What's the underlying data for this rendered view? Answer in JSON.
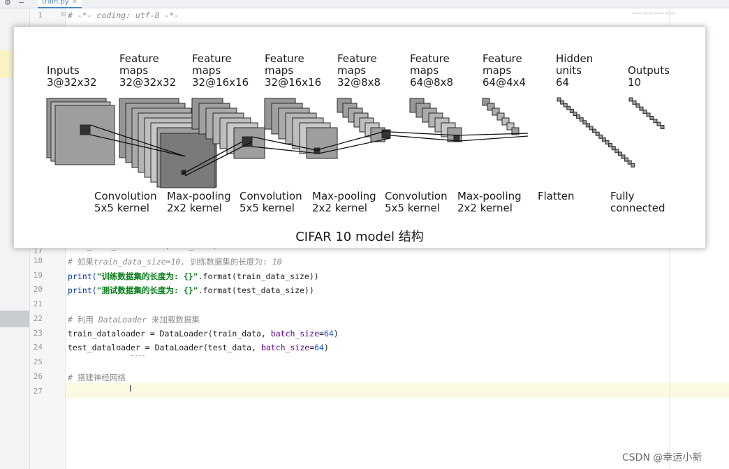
{
  "tabs": [
    {
      "label": "train.py"
    }
  ],
  "code_lines": [
    {
      "n": "1",
      "text": "# -*- coding: utf-8 -*-"
    },
    {
      "n": "17",
      "text": "test_data_size = len(test_data)"
    },
    {
      "n": "18",
      "text": "# 如果train_data_size=10, 训练数据集的长度为: 10"
    },
    {
      "n": "19",
      "text": "print(\"训练数据集的长度为: {}\".format(train_data_size))"
    },
    {
      "n": "20",
      "text": "print(\"测试数据集的长度为: {}\".format(test_data_size))"
    },
    {
      "n": "21",
      "text": ""
    },
    {
      "n": "22",
      "text": "# 利用 DataLoader 来加载数据集"
    },
    {
      "n": "23",
      "text": "train_dataloader = DataLoader(train_data, batch_size=64)"
    },
    {
      "n": "24",
      "text": "test_dataloader = DataLoader(test_data, batch_size=64)"
    },
    {
      "n": "25",
      "text": ""
    },
    {
      "n": "26",
      "text": "# 搭建神经网络"
    },
    {
      "n": "27",
      "text": ""
    }
  ],
  "code_parts": {
    "l18_a": "# 如果",
    "l18_b": "train_data_size=10,",
    "l18_c": " 训练数据集的长度为: ",
    "l18_d": "10",
    "l19_a": "print(",
    "l19_b": "\"训练数据集的长度为: {}\"",
    "l19_c": ".format(train_data_size))",
    "l20_a": "print(",
    "l20_b": "\"测试数据集的长度为: {}\"",
    "l20_c": ".format(test_data_size))",
    "l22_a": "# 利用 ",
    "l22_b": "DataLoader",
    "l22_c": " 来加载数据集",
    "l23_a": "train_dataloader = DataLoader(train_data, ",
    "l23_b": "batch_size",
    "l23_c": "=",
    "l23_d": "64",
    "l23_e": ")",
    "l24_a": "test_dataloader = DataLoader(test_data, ",
    "l24_b": "batch_size",
    "l24_c": "=",
    "l24_d": "64",
    "l24_e": ")",
    "l26": "# 搭建神经网络"
  },
  "figure": {
    "headers": [
      {
        "label": "Inputs\n3@32x32"
      },
      {
        "label": "Feature\nmaps\n32@32x32"
      },
      {
        "label": "Feature\nmaps\n32@16x16"
      },
      {
        "label": "Feature\nmaps\n32@16x16"
      },
      {
        "label": "Feature\nmaps\n32@8x8"
      },
      {
        "label": "Feature\nmaps\n64@8x8"
      },
      {
        "label": "Feature\nmaps\n64@4x4"
      },
      {
        "label": "Hidden\nunits\n64"
      },
      {
        "label": "Outputs\n10"
      }
    ],
    "operations": [
      {
        "label": "Convolution\n5x5 kernel"
      },
      {
        "label": "Max-pooling\n2x2 kernel"
      },
      {
        "label": "Convolution\n5x5 kernel"
      },
      {
        "label": "Max-pooling\n2x2 kernel"
      },
      {
        "label": "Convolution\n5x5 kernel"
      },
      {
        "label": "Max-pooling\n2x2 kernel"
      },
      {
        "label": "Flatten"
      },
      {
        "label": "Fully\nconnected"
      }
    ],
    "caption": "CIFAR 10 model 结构"
  },
  "watermark": "CSDN @幸运小新",
  "colors": {
    "comment": "#8c8c8c",
    "string": "#067d17",
    "kwarg": "#660099",
    "number": "#1750eb",
    "builtin": "#0033b3",
    "current_line": "#fcf9e2"
  }
}
